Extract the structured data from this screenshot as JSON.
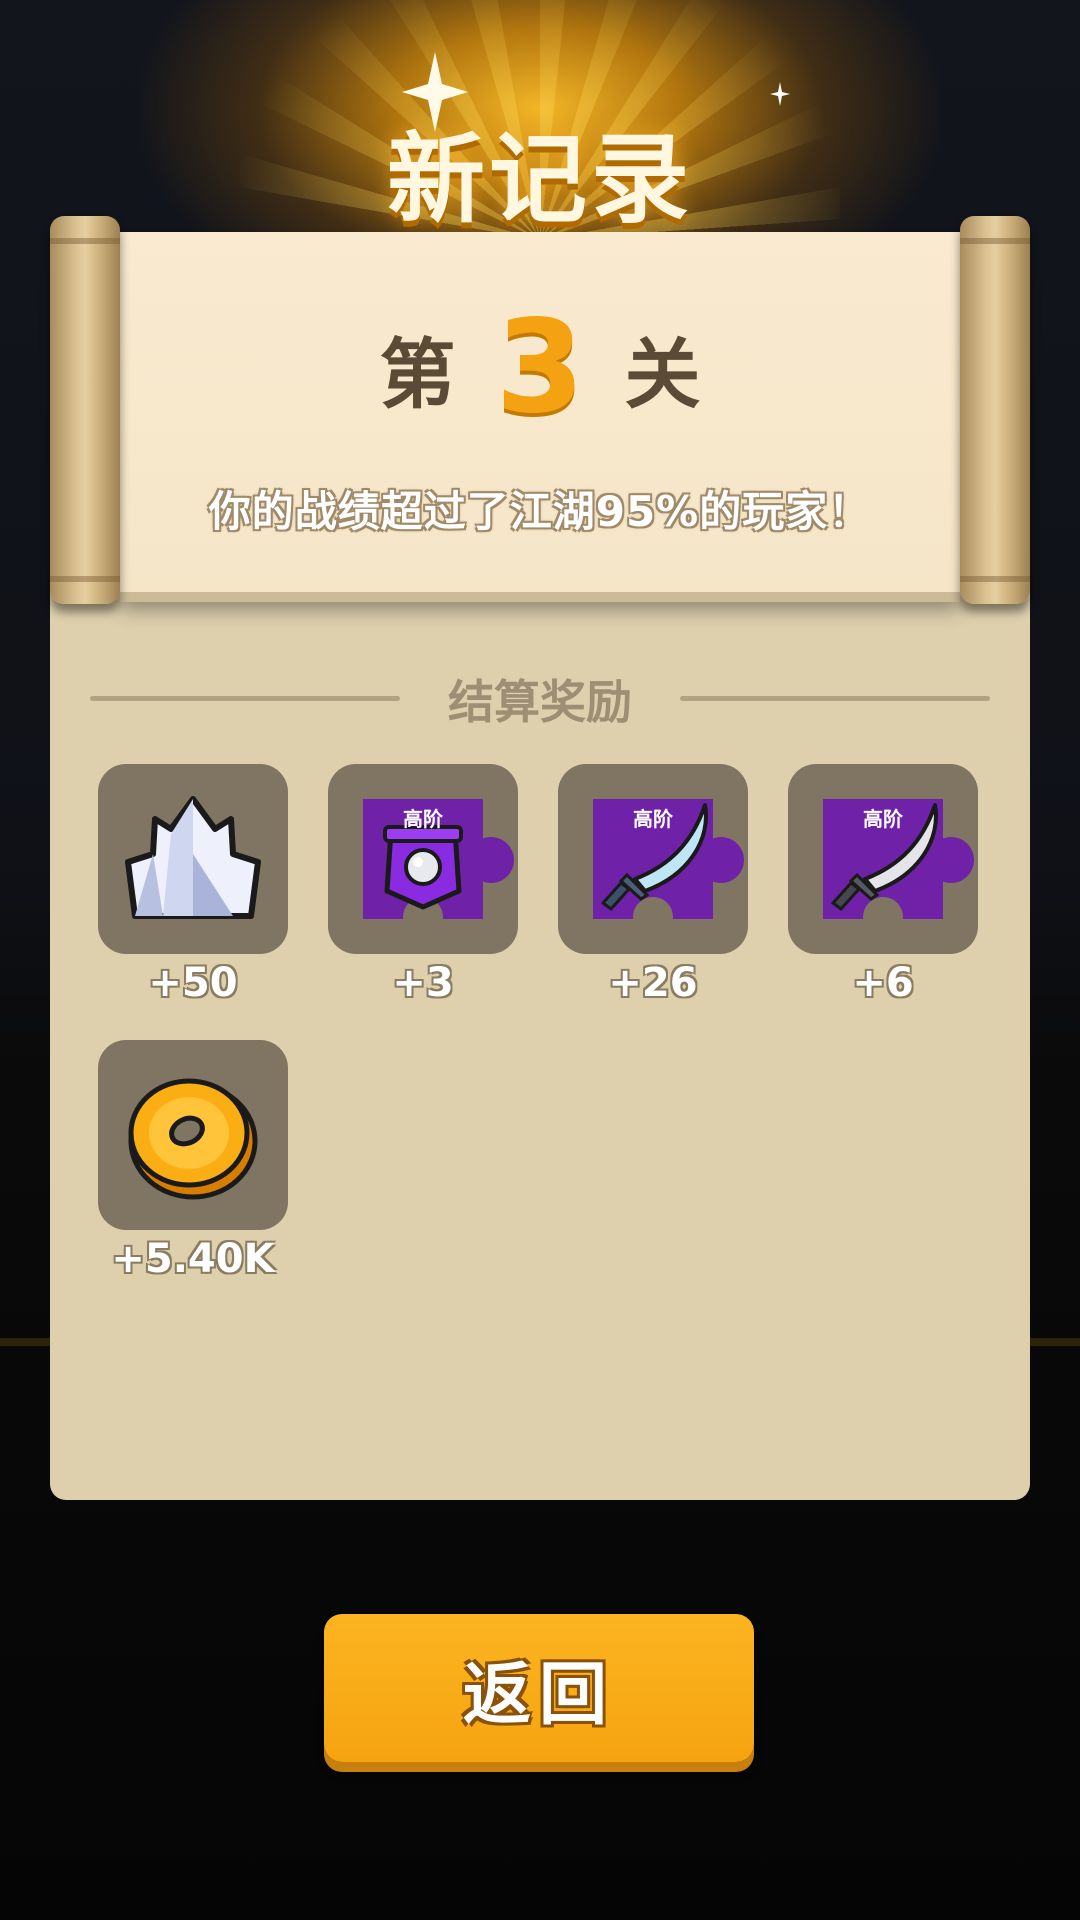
{
  "header": {
    "title": "新记录"
  },
  "result": {
    "level_prefix": "第",
    "level_number": "3",
    "level_suffix": "关",
    "subtitle": "你的战绩超过了江湖95%的玩家！"
  },
  "rewards": {
    "section_title": "结算奖励",
    "items": [
      {
        "icon": "crystal-icon",
        "count": "+50"
      },
      {
        "icon": "armor-shard-icon",
        "tier": "高阶",
        "count": "+3"
      },
      {
        "icon": "ice-saber-shard-icon",
        "tier": "高阶",
        "count": "+26"
      },
      {
        "icon": "silver-saber-shard-icon",
        "tier": "高阶",
        "count": "+6"
      },
      {
        "icon": "gold-coin-icon",
        "count": "+5.40K"
      }
    ]
  },
  "actions": {
    "return_label": "返回"
  },
  "colors": {
    "accent": "#f5a410",
    "panel": "#ded0ad",
    "slot": "#7f7562",
    "puzzle": "#6f22a8"
  }
}
